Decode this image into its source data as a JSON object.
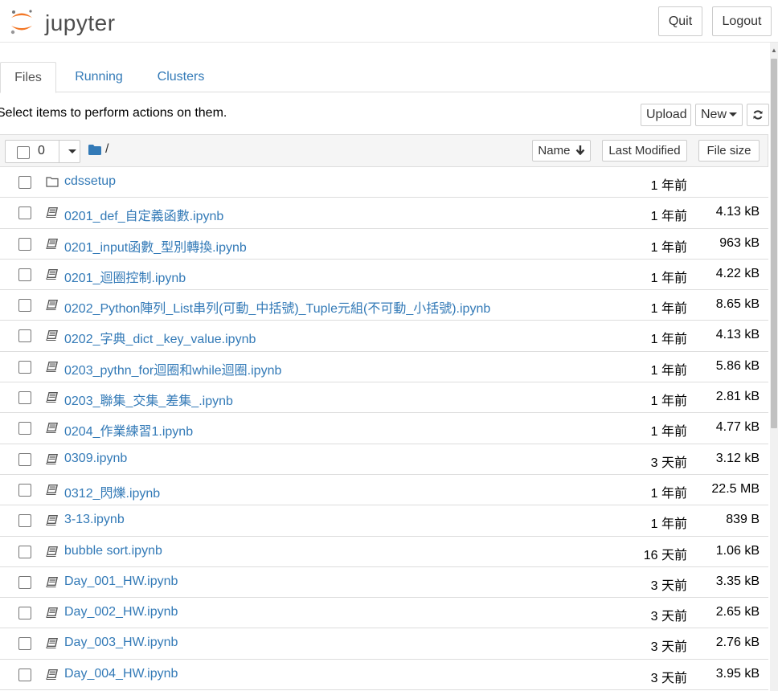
{
  "header": {
    "logo_text": "jupyter",
    "quit_label": "Quit",
    "logout_label": "Logout"
  },
  "tabs": [
    {
      "label": "Files",
      "active": true
    },
    {
      "label": "Running",
      "active": false
    },
    {
      "label": "Clusters",
      "active": false
    }
  ],
  "toolbar": {
    "hint": "Select items to perform actions on them.",
    "upload_label": "Upload",
    "new_label": "New"
  },
  "list_header": {
    "selected_count": "0",
    "breadcrumb": "/",
    "sort_name_label": "Name",
    "sort_modified_label": "Last Modified",
    "sort_size_label": "File size"
  },
  "files": [
    {
      "name": "cdssetup",
      "type": "folder",
      "modified": "1 年前",
      "size": ""
    },
    {
      "name": "0201_def_自定義函數.ipynb",
      "type": "notebook",
      "modified": "1 年前",
      "size": "4.13 kB"
    },
    {
      "name": "0201_input函數_型別轉換.ipynb",
      "type": "notebook",
      "modified": "1 年前",
      "size": "963 kB"
    },
    {
      "name": "0201_迴圈控制.ipynb",
      "type": "notebook",
      "modified": "1 年前",
      "size": "4.22 kB"
    },
    {
      "name": "0202_Python陣列_List串列(可動_中括號)_Tuple元組(不可動_小括號).ipynb",
      "type": "notebook",
      "modified": "1 年前",
      "size": "8.65 kB"
    },
    {
      "name": "0202_字典_dict _key_value.ipynb",
      "type": "notebook",
      "modified": "1 年前",
      "size": "4.13 kB"
    },
    {
      "name": "0203_pythn_for迴圈和while迴圈.ipynb",
      "type": "notebook",
      "modified": "1 年前",
      "size": "5.86 kB"
    },
    {
      "name": "0203_聯集_交集_差集_.ipynb",
      "type": "notebook",
      "modified": "1 年前",
      "size": "2.81 kB"
    },
    {
      "name": "0204_作業練習1.ipynb",
      "type": "notebook",
      "modified": "1 年前",
      "size": "4.77 kB"
    },
    {
      "name": "0309.ipynb",
      "type": "notebook",
      "modified": "3 天前",
      "size": "3.12 kB"
    },
    {
      "name": "0312_閃爍.ipynb",
      "type": "notebook",
      "modified": "1 年前",
      "size": "22.5 MB"
    },
    {
      "name": "3-13.ipynb",
      "type": "notebook",
      "modified": "1 年前",
      "size": "839 B"
    },
    {
      "name": "bubble sort.ipynb",
      "type": "notebook",
      "modified": "16 天前",
      "size": "1.06 kB"
    },
    {
      "name": "Day_001_HW.ipynb",
      "type": "notebook",
      "modified": "3 天前",
      "size": "3.35 kB"
    },
    {
      "name": "Day_002_HW.ipynb",
      "type": "notebook",
      "modified": "3 天前",
      "size": "2.65 kB"
    },
    {
      "name": "Day_003_HW.ipynb",
      "type": "notebook",
      "modified": "3 天前",
      "size": "2.76 kB"
    },
    {
      "name": "Day_004_HW.ipynb",
      "type": "notebook",
      "modified": "3 天前",
      "size": "3.95 kB"
    }
  ],
  "colors": {
    "link": "#337ab7",
    "logo_orange": "#f37726",
    "folder_blue": "#337ab7"
  }
}
